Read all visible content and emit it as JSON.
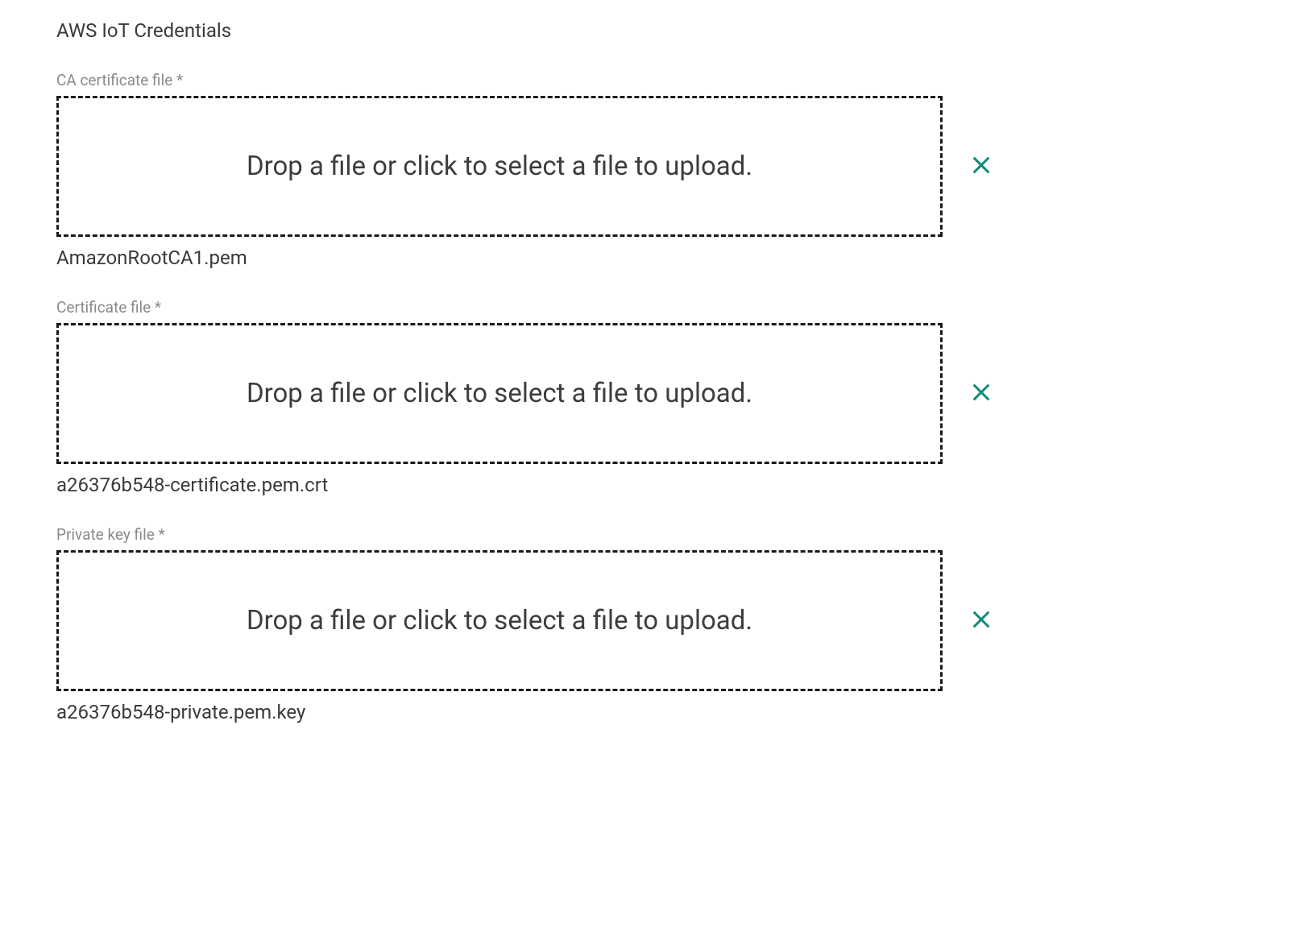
{
  "section": {
    "title": "AWS IoT Credentials"
  },
  "fields": {
    "ca_cert": {
      "label": "CA certificate file *",
      "dropzone_text": "Drop a file or click to select a file to upload.",
      "filename": "AmazonRootCA1.pem"
    },
    "cert": {
      "label": "Certificate file *",
      "dropzone_text": "Drop a file or click to select a file to upload.",
      "filename": "a26376b548-certificate.pem.crt"
    },
    "private_key": {
      "label": "Private key file *",
      "dropzone_text": "Drop a file or click to select a file to upload.",
      "filename": "a26376b548-private.pem.key"
    }
  },
  "colors": {
    "accent": "#0e8a7a"
  }
}
